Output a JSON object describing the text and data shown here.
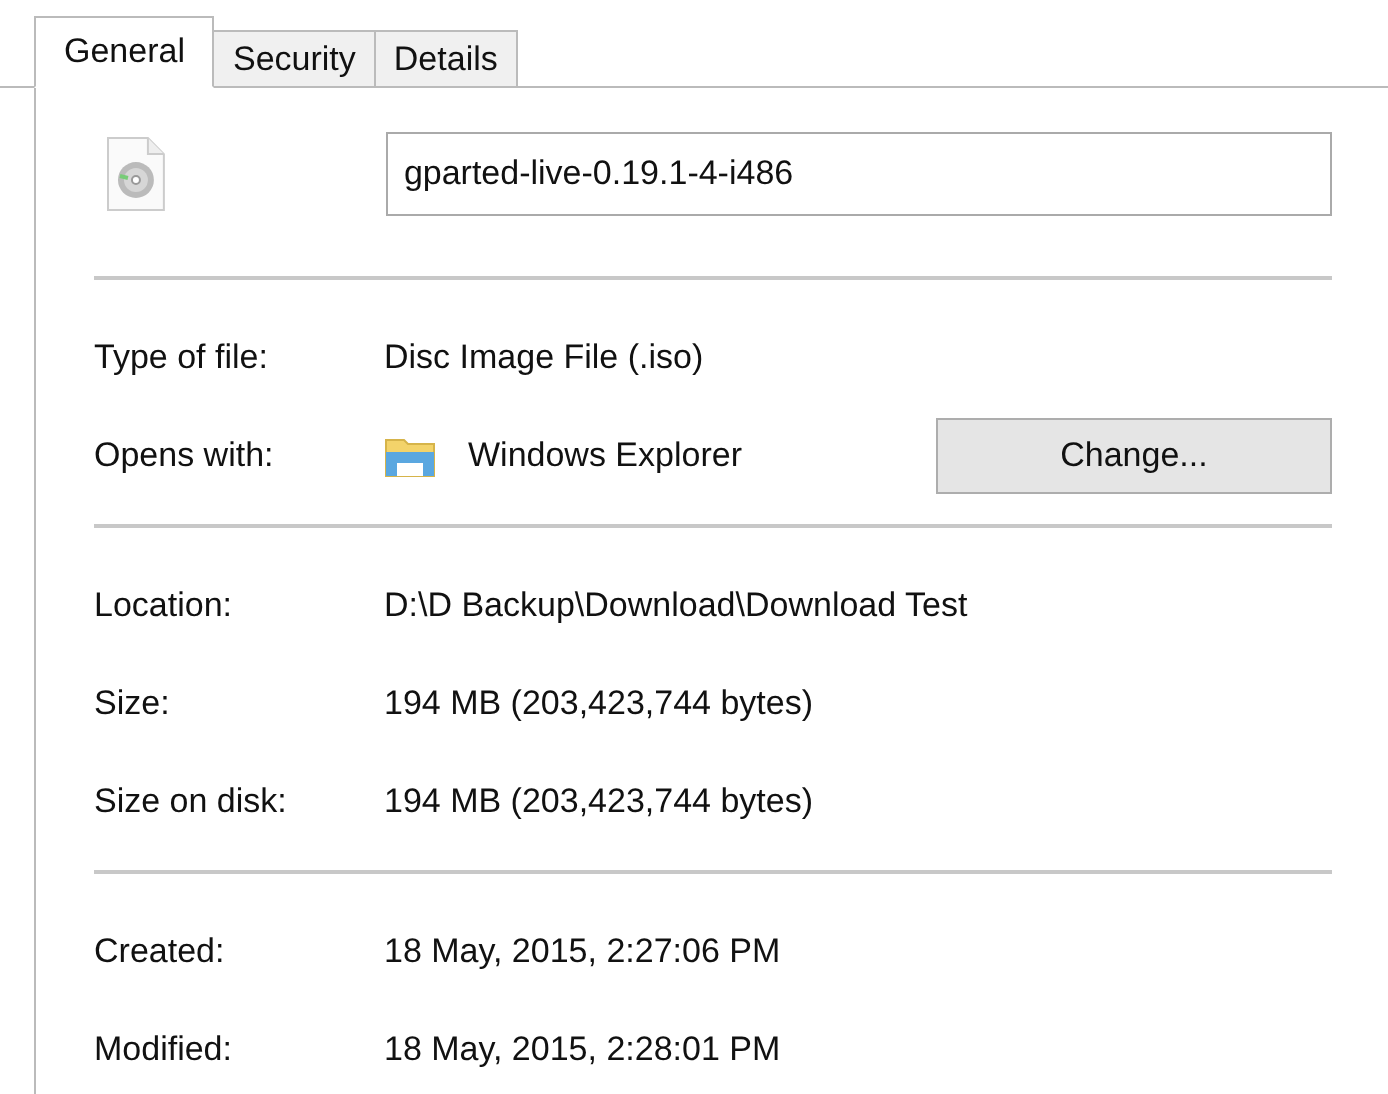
{
  "tabs": [
    {
      "label": "General",
      "selected": true
    },
    {
      "label": "Security",
      "selected": false
    },
    {
      "label": "Details",
      "selected": false
    }
  ],
  "file_name": {
    "value": "gparted-live-0.19.1-4-i486"
  },
  "sections": [
    {
      "rows": [
        {
          "label": "Type of file:",
          "value": "Disc Image File (.iso)"
        },
        {
          "label": "Opens with:",
          "value": "Windows Explorer",
          "kind": "app",
          "button": "Change..."
        }
      ]
    },
    {
      "rows": [
        {
          "label": "Location:",
          "value": "D:\\D Backup\\Download\\Download Test"
        },
        {
          "label": "Size:",
          "value": "194 MB (203,423,744 bytes)"
        },
        {
          "label": "Size on disk:",
          "value": "194 MB (203,423,744 bytes)"
        }
      ]
    },
    {
      "rows": [
        {
          "label": "Created:",
          "value": "18 May, 2015, 2:27:06 PM"
        },
        {
          "label": "Modified:",
          "value": "18 May, 2015, 2:28:01 PM"
        }
      ]
    }
  ]
}
